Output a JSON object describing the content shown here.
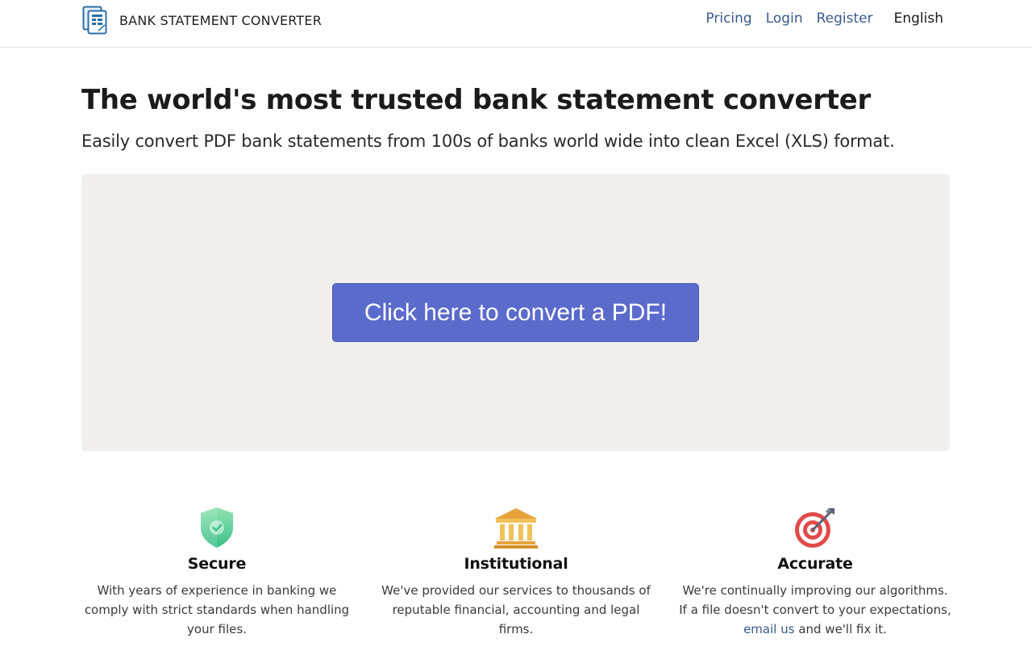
{
  "header": {
    "brand": "BANK STATEMENT CONVERTER",
    "brand_icon": "document-table-icon",
    "nav": [
      {
        "label": "Pricing"
      },
      {
        "label": "Login"
      },
      {
        "label": "Register"
      }
    ],
    "language": "English"
  },
  "hero": {
    "title": "The world's most trusted bank statement converter",
    "subtitle": "Easily convert PDF bank statements from 100s of banks world wide into clean Excel (XLS) format.",
    "cta_label": "Click here to convert a PDF!"
  },
  "features": [
    {
      "icon": "shield-check-icon",
      "title": "Secure",
      "text": "With years of experience in banking we comply with strict standards when handling your files."
    },
    {
      "icon": "bank-building-icon",
      "title": "Institutional",
      "text": "We've provided our services to thousands of reputable financial, accounting and legal firms."
    },
    {
      "icon": "target-arrow-icon",
      "title": "Accurate",
      "text_before": "We're continually improving our algorithms. If a file doesn't convert to your expectations,",
      "link": "email us",
      "text_after": "and we'll fix it."
    }
  ],
  "colors": {
    "accent_button": "#5b6bcc",
    "link": "#3a5a8c",
    "dropzone_bg": "#f0efee"
  }
}
